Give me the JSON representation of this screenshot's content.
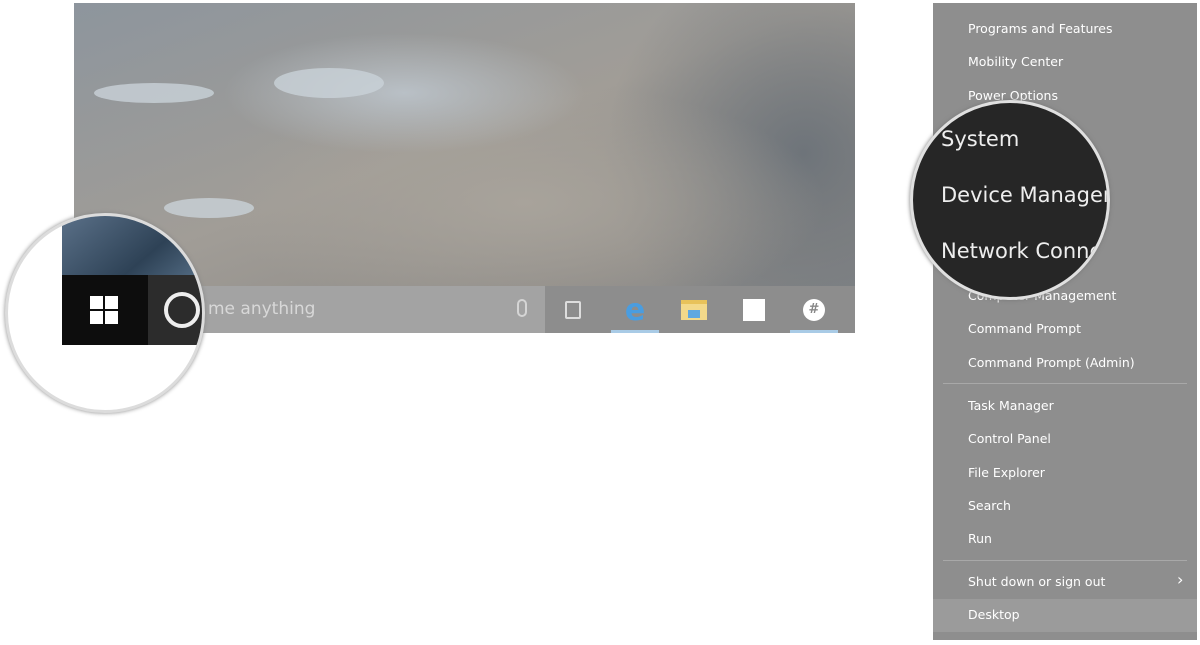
{
  "taskbar": {
    "search_placeholder": "me anything",
    "icons": [
      "start-windows-icon",
      "cortana-icon",
      "microphone-icon",
      "task-view-icon",
      "edge-icon",
      "file-explorer-icon",
      "store-icon",
      "slack-icon"
    ]
  },
  "menu": {
    "items": [
      {
        "label": "Programs and Features"
      },
      {
        "label": "Mobility Center"
      },
      {
        "label": "Power Options"
      },
      {
        "label": "Computer Management"
      },
      {
        "label": "Command Prompt"
      },
      {
        "label": "Command Prompt (Admin)"
      },
      {
        "label": "Task Manager"
      },
      {
        "label": "Control Panel"
      },
      {
        "label": "File Explorer"
      },
      {
        "label": "Search"
      },
      {
        "label": "Run"
      },
      {
        "label": "Shut down or sign out"
      },
      {
        "label": "Desktop"
      }
    ],
    "magnified": [
      "System",
      "Device Manager",
      "Network Connec"
    ]
  },
  "colors": {
    "menu_bg": "#8e8e8e",
    "magnifier_bg": "#262626",
    "edge_blue": "#4a9de0"
  }
}
